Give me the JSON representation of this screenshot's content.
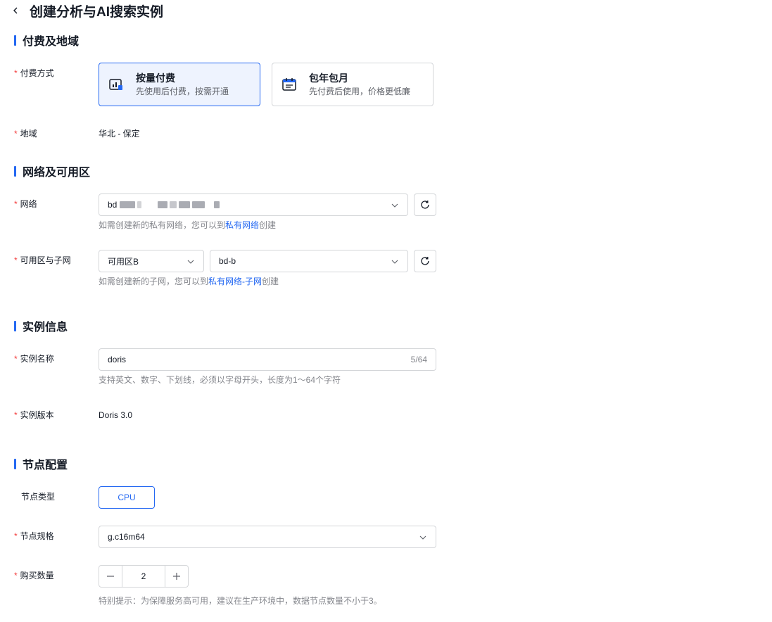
{
  "header": {
    "title": "创建分析与AI搜索实例"
  },
  "colors": {
    "accent": "#2468f2",
    "required": "#f33e3e"
  },
  "sections": {
    "billing": {
      "title": "付费及地域"
    },
    "network": {
      "title": "网络及可用区"
    },
    "instance": {
      "title": "实例信息"
    },
    "node": {
      "title": "节点配置"
    }
  },
  "billing": {
    "mode_label": "付费方式",
    "options": [
      {
        "title": "按量付费",
        "desc": "先使用后付费，按需开通",
        "selected": true,
        "icon": "bar-chart-icon"
      },
      {
        "title": "包年包月",
        "desc": "先付费后使用，价格更低廉",
        "selected": false,
        "icon": "calendar-icon"
      }
    ],
    "region_label": "地域",
    "region_value": "华北 - 保定"
  },
  "network": {
    "vpc_label": "网络",
    "vpc_value_prefix": "bd",
    "vpc_hint_prefix": "如需创建新的私有网络，您可以到",
    "vpc_hint_link": "私有网络",
    "vpc_hint_suffix": "创建",
    "zone_label": "可用区与子网",
    "zone_value": "可用区B",
    "subnet_value": "bd-b",
    "subnet_hint_prefix": "如需创建新的子网，您可以到",
    "subnet_hint_link": "私有网络-子网",
    "subnet_hint_suffix": "创建"
  },
  "instance": {
    "name_label": "实例名称",
    "name_value": "doris",
    "name_count": "5/64",
    "name_hint": "支持英文、数字、下划线，必须以字母开头，长度为1～64个字符",
    "version_label": "实例版本",
    "version_value": "Doris 3.0"
  },
  "node": {
    "type_label": "节点类型",
    "type_value": "CPU",
    "spec_label": "节点规格",
    "spec_value": "g.c16m64",
    "qty_label": "购买数量",
    "qty_value": "2",
    "qty_hint": "特别提示：为保障服务高可用，建议在生产环境中，数据节点数量不小于3。"
  }
}
